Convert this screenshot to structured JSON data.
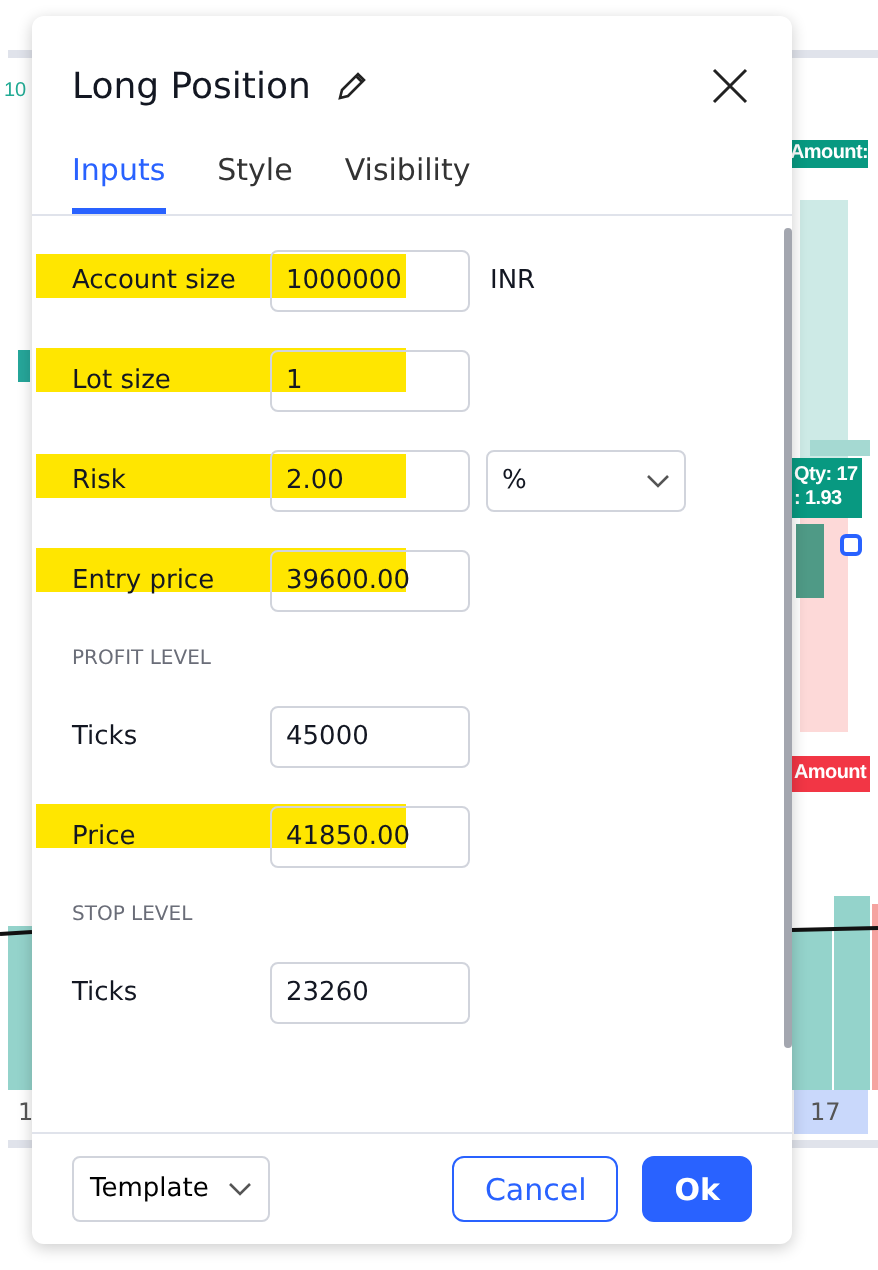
{
  "background": {
    "price_label": "10",
    "badges": [
      {
        "text": "Amount:",
        "kind": "profit"
      },
      {
        "text": "Qty: 17\n: 1.93",
        "kind": "position"
      },
      {
        "text": "Amount",
        "kind": "loss"
      }
    ],
    "axis_labels": [
      "1",
      "17"
    ]
  },
  "dialog": {
    "title": "Long Position",
    "tabs": [
      {
        "label": "Inputs",
        "selected": true
      },
      {
        "label": "Style",
        "selected": false
      },
      {
        "label": "Visibility",
        "selected": false
      }
    ],
    "sections": [
      {
        "rows": [
          {
            "kind": "input",
            "label": "Account size",
            "value": "1000000",
            "unit": "INR",
            "highlighted": true
          },
          {
            "kind": "input",
            "label": "Lot size",
            "value": "1",
            "highlighted": true
          },
          {
            "kind": "select",
            "label": "Risk",
            "value": "2.00",
            "option": "%",
            "highlighted": true
          },
          {
            "kind": "input",
            "label": "Entry price",
            "value": "39600.00",
            "highlighted": true
          }
        ]
      },
      {
        "heading": "PROFIT LEVEL",
        "rows": [
          {
            "kind": "input",
            "label": "Ticks",
            "value": "45000",
            "highlighted": false
          },
          {
            "kind": "input",
            "label": "Price",
            "value": "41850.00",
            "highlighted": true
          }
        ]
      },
      {
        "heading": "STOP LEVEL",
        "rows": [
          {
            "kind": "input",
            "label": "Ticks",
            "value": "23260",
            "highlighted": false
          }
        ]
      }
    ],
    "template": "Template",
    "buttons": [
      {
        "label": "Cancel",
        "kind": "secondary"
      },
      {
        "label": "Ok",
        "kind": "primary"
      }
    ]
  }
}
